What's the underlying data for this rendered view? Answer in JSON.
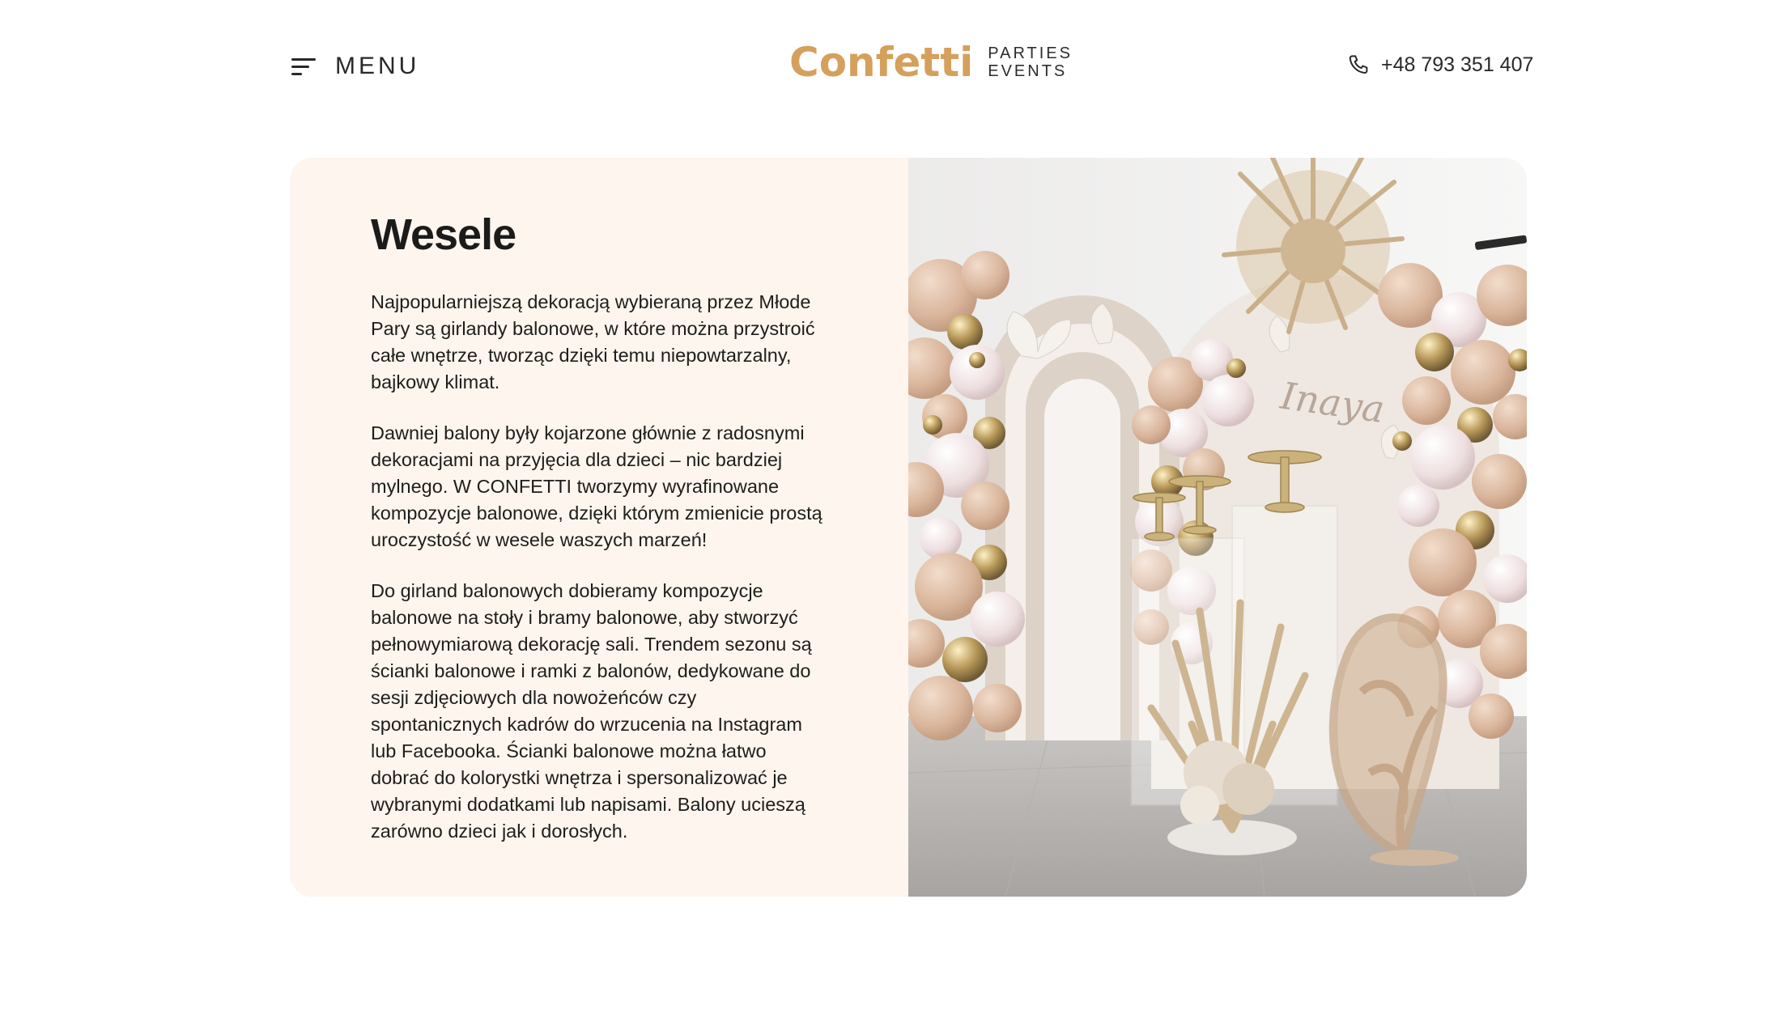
{
  "header": {
    "menu_label": "MENU",
    "logo_word": "Confetti",
    "logo_tag_line1": "PARTIES",
    "logo_tag_line2": "EVENTS",
    "phone": "+48 793 351 407",
    "menu_icon": "hamburger-icon",
    "phone_icon": "phone-icon"
  },
  "section": {
    "title": "Wesele",
    "paragraphs": [
      "Najpopularniejszą dekoracją wybieraną przez Młode Pary są girlandy balonowe, w które można przystroić całe wnętrze, tworząc dzięki temu niepowtarzalny, bajkowy klimat.",
      "Dawniej balony były kojarzone głównie z radosnymi dekoracjami na przyjęcia dla dzieci – nic bardziej mylnego. W CONFETTI  tworzymy wyrafinowane kompozycje balonowe, dzięki którym zmienicie prostą uroczystość w wesele waszych marzeń!",
      "Do girland balonowych dobieramy kompozycje balonowe na stoły i bramy balonowe, aby stworzyć pełnowymiarową dekorację sali. Trendem sezonu są ścianki balonowe i ramki z balonów, dedykowane do sesji zdjęciowych dla nowożeńców czy spontanicznych kadrów do wrzucenia na Instagram lub Facebooka. Ścianki balonowe można łatwo dobrać do kolorystki wnętrza i spersonalizować je wybranymi dodatkami lub napisami. Balony ucieszą zarówno dzieci jak i dorosłych."
    ],
    "photo_script_text": "Inaya"
  },
  "colors": {
    "accent": "#d5a05c",
    "card_bg": "#fdf5ee",
    "text": "#1f1d1b"
  }
}
